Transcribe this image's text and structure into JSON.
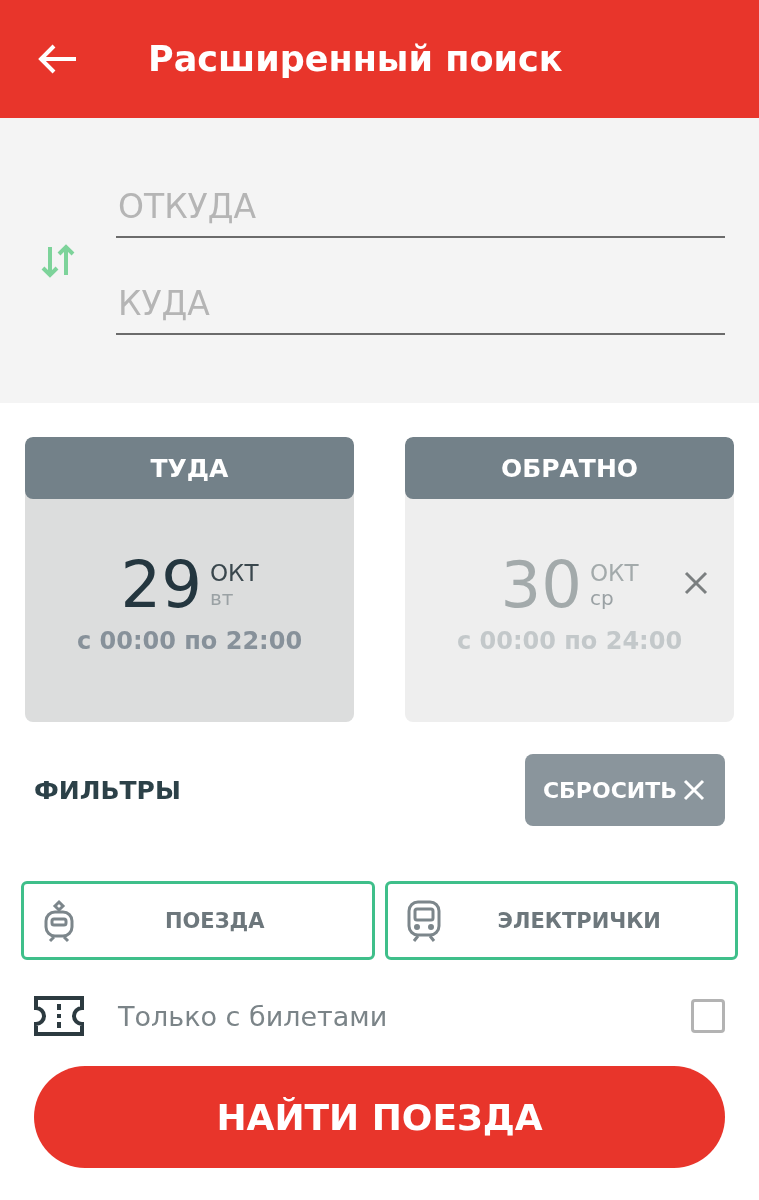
{
  "header": {
    "title": "Расширенный поиск"
  },
  "route": {
    "from": {
      "placeholder": "ОТКУДА"
    },
    "to": {
      "placeholder": "КУДА"
    }
  },
  "dates": [
    {
      "label": "ТУДА",
      "day": "29",
      "month": "ОКТ",
      "weekday": "вт",
      "time": "с 00:00 по 22:00",
      "active": true,
      "clearable": false
    },
    {
      "label": "ОБРАТНО",
      "day": "30",
      "month": "ОКТ",
      "weekday": "ср",
      "time": "с 00:00 по 24:00",
      "active": false,
      "clearable": true
    }
  ],
  "filters": {
    "title": "ФИЛЬТРЫ",
    "reset": "СБРОСИТЬ"
  },
  "transport": [
    {
      "kind": "train",
      "label": "ПОЕЗДА",
      "selected": true
    },
    {
      "kind": "suburban",
      "label": "ЭЛЕКТРИЧКИ",
      "selected": true
    }
  ],
  "tickets_only": {
    "label": "Только с билетами",
    "checked": false
  },
  "search_button": "НАЙТИ ПОЕЗДА"
}
